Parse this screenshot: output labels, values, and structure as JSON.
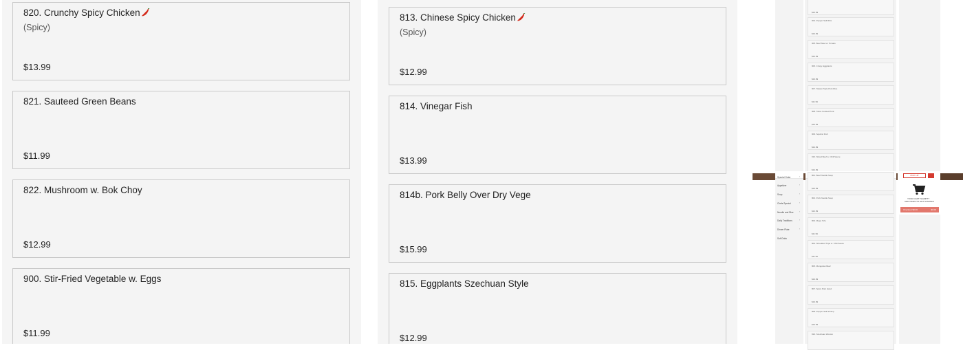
{
  "menu_left": [
    {
      "name": "820. Crunchy Spicy Chicken",
      "spicy_icon": true,
      "subtitle": "(Spicy)",
      "price": "$13.99"
    },
    {
      "name": "821. Sauteed Green Beans",
      "spicy_icon": false,
      "subtitle": "",
      "price": "$11.99"
    },
    {
      "name": "822. Mushroom w. Bok Choy",
      "spicy_icon": false,
      "subtitle": "",
      "price": "$12.99"
    },
    {
      "name": "900. Stir-Fried Vegetable w. Eggs",
      "spicy_icon": false,
      "subtitle": "",
      "price": "$11.99"
    }
  ],
  "menu_right": [
    {
      "name": "813. Chinese Spicy Chicken",
      "spicy_icon": true,
      "subtitle": "(Spicy)",
      "price": "$12.99"
    },
    {
      "name": "814. Vinegar Fish",
      "spicy_icon": false,
      "subtitle": "",
      "price": "$13.99"
    },
    {
      "name": "814b. Pork Belly Over Dry Vege",
      "spicy_icon": false,
      "subtitle": "",
      "price": "$15.99"
    },
    {
      "name": "815. Eggplants Szechuan Style",
      "spicy_icon": false,
      "subtitle": "",
      "price": "$12.99"
    }
  ],
  "thumbnail": {
    "upper_items": [
      {
        "name": "",
        "price": "$13.99"
      },
      {
        "name": "904. Pepper Salt Ribs",
        "price": "$13.99"
      },
      {
        "name": "905. Beef Stew w. Tomato",
        "price": "$13.99"
      },
      {
        "name": "906. Crispy Eggplants",
        "price": "$13.99"
      },
      {
        "name": "907. Taiwan Style Pork Rice",
        "price": "$11.99"
      },
      {
        "name": "908. Twice Cooked Pork",
        "price": "$13.99"
      },
      {
        "name": "909. Squirrel Fish",
        "price": "$14.99"
      },
      {
        "name": "910. Sliced Beef w. Chili Sauce",
        "price": "$14.99"
      }
    ],
    "lower_items": [
      {
        "name": "801. Beef Noodle Soup",
        "price": "$13.99"
      },
      {
        "name": "802. Pork Noodle Soup",
        "price": "$12.99"
      },
      {
        "name": "803. Mapo Tofu",
        "price": "$11.99"
      },
      {
        "name": "804. Shredded Tripe w. Chili Sauce",
        "price": "$11.99"
      },
      {
        "name": "805. Mongolian Beef",
        "price": "$13.99"
      },
      {
        "name": "807. Spicy Pork Hand",
        "price": "$13.99"
      },
      {
        "name": "808. Pepper Salt Shrimp",
        "price": "$13.99"
      },
      {
        "name": "810. Szechuan Wonton",
        "price": ""
      }
    ],
    "categories": [
      "Special Order",
      "Appetizer",
      "Soup",
      "Chefs Special",
      "Noodle and Rice",
      "Daily Traditions",
      "Dinner Plate",
      "Soft Drink"
    ],
    "pickup_label": "PICK UP",
    "cart_empty_line1": "YOUR CART IS EMPTY",
    "cart_empty_line2": "ADD ITEMS TO GET STARTED",
    "checkout_label": "Checkout $0.00",
    "checkout_amount": "$0.00"
  },
  "colors": {
    "accent": "#d43a2f",
    "card_border": "#c9c9c9",
    "panel_bg": "#f5f5f5",
    "chili": "#d42a1a"
  }
}
